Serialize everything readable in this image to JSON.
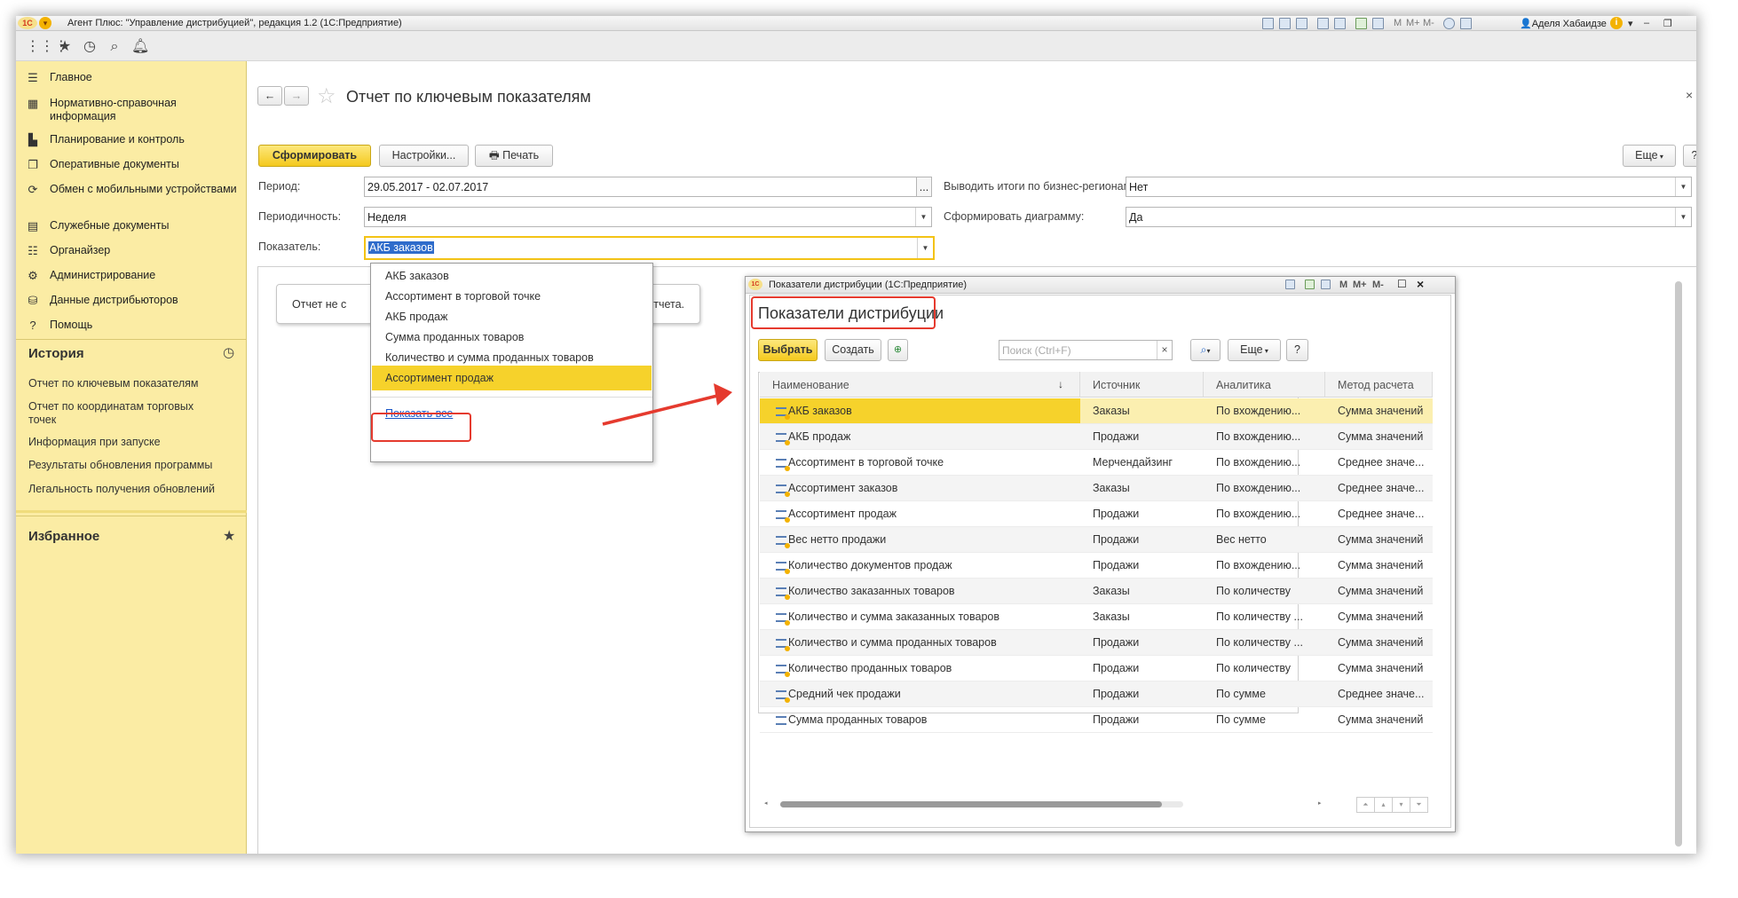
{
  "window": {
    "title": "Агент Плюс: \"Управление дистрибуцией\", редакция 1.2  (1С:Предприятие)",
    "logo": "1С",
    "user": "Аделя Хабаидзе",
    "titlebar_tools": [
      "M",
      "M+",
      "M-"
    ]
  },
  "sidebar": {
    "items": [
      {
        "label": "Главное",
        "icon": "menu-lines-icon"
      },
      {
        "label": "Нормативно-справочная информация",
        "icon": "catalog-icon"
      },
      {
        "label": "Планирование и контроль",
        "icon": "chart-icon"
      },
      {
        "label": "Оперативные документы",
        "icon": "documents-icon"
      },
      {
        "label": "Обмен с мобильными устройствами",
        "icon": "sync-icon"
      },
      {
        "label": "Служебные документы",
        "icon": "service-docs-icon"
      },
      {
        "label": "Органайзер",
        "icon": "organizer-icon"
      },
      {
        "label": "Администрирование",
        "icon": "gear-icon"
      },
      {
        "label": "Данные дистрибьюторов",
        "icon": "distributors-icon"
      },
      {
        "label": "Помощь",
        "icon": "help-icon"
      }
    ],
    "history_title": "История",
    "history": [
      "Отчет по ключевым показателям",
      "Отчет по координатам торговых точек",
      "Информация при запуске",
      "Результаты обновления программы",
      "Легальность получения обновлений"
    ],
    "favorites_title": "Избранное"
  },
  "page": {
    "title": "Отчет по ключевым показателям",
    "btn_generate": "Сформировать",
    "btn_settings": "Настройки...",
    "btn_print": "Печать",
    "btn_more": "Еще",
    "btn_help": "?",
    "period_label": "Период:",
    "period_value": "29.05.2017 - 02.07.2017",
    "period_btn": "...",
    "periodicity_label": "Периодичность:",
    "periodicity_value": "Неделя",
    "indicator_label": "Показатель:",
    "indicator_value": "АКБ заказов",
    "regions_label": "Выводить итоги по бизнес-регионам:",
    "regions_value": "Нет",
    "diagram_label": "Сформировать диаграмму:",
    "diagram_value": "Да",
    "report_msg_left": "Отчет не с",
    "report_msg_right": "ля отчета."
  },
  "dropdown": {
    "items": [
      "АКБ заказов",
      "Ассортимент в торговой точке",
      "АКБ продаж",
      "Сумма проданных товаров",
      "Количество и сумма проданных товаров",
      "Ассортимент продаж"
    ],
    "selected_index": 5,
    "show_all": "Показать все"
  },
  "dialog": {
    "window_title": "Показатели дистрибуции  (1С:Предприятие)",
    "window_tools": [
      "M",
      "M+",
      "M-"
    ],
    "heading": "Показатели дистрибуции",
    "btn_select": "Выбрать",
    "btn_create": "Создать",
    "search_placeholder": "Поиск (Ctrl+F)",
    "btn_more": "Еще",
    "btn_help": "?",
    "columns": [
      "Наименование",
      "Источник",
      "Аналитика",
      "Метод расчета"
    ],
    "rows": [
      [
        "АКБ заказов",
        "Заказы",
        "По вхождению...",
        "Сумма значений"
      ],
      [
        "АКБ продаж",
        "Продажи",
        "По вхождению...",
        "Сумма значений"
      ],
      [
        "Ассортимент в торговой точке",
        "Мерчендайзинг",
        "По вхождению...",
        "Среднее значе..."
      ],
      [
        "Ассортимент заказов",
        "Заказы",
        "По вхождению...",
        "Среднее значе..."
      ],
      [
        "Ассортимент продаж",
        "Продажи",
        "По вхождению...",
        "Среднее значе..."
      ],
      [
        "Вес нетто продажи",
        "Продажи",
        "Вес нетто",
        "Сумма значений"
      ],
      [
        "Количество документов продаж",
        "Продажи",
        "По вхождению...",
        "Сумма значений"
      ],
      [
        "Количество заказанных товаров",
        "Заказы",
        "По количеству",
        "Сумма значений"
      ],
      [
        "Количество и сумма заказанных товаров",
        "Заказы",
        "По количеству ...",
        "Сумма значений"
      ],
      [
        "Количество и сумма проданных товаров",
        "Продажи",
        "По количеству ...",
        "Сумма значений"
      ],
      [
        "Количество проданных товаров",
        "Продажи",
        "По количеству",
        "Сумма значений"
      ],
      [
        "Средний чек продажи",
        "Продажи",
        "По сумме",
        "Среднее значе..."
      ],
      [
        "Сумма проданных товаров",
        "Продажи",
        "По сумме",
        "Сумма значений"
      ]
    ],
    "selected_row": 0
  },
  "colors": {
    "sidebar_bg": "#fbeca4",
    "accent_yellow": "#f4c91e",
    "selection": "#f6d22b",
    "highlight_red": "#e53a2e",
    "link_blue": "#1a56c8"
  }
}
